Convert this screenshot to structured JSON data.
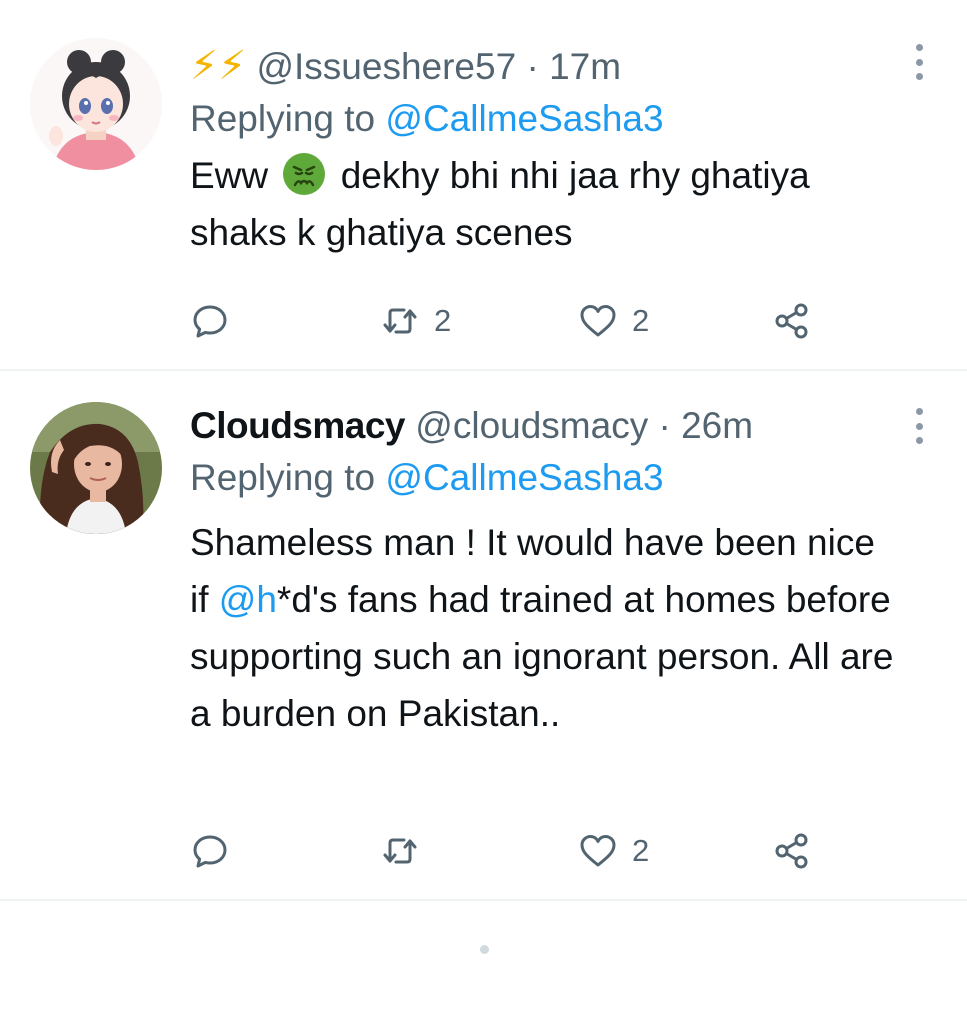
{
  "tweets": [
    {
      "display_name": "",
      "handle": "@Issueshere57",
      "time": "17m",
      "replying_prefix": "Replying to",
      "replying_to": "@CallmeSasha3",
      "text_part1": "Eww",
      "text_part2": "dekhy bhi nhi jaa rhy ghatiya shaks k ghatiya scenes",
      "retweets": "2",
      "likes": "2"
    },
    {
      "display_name": "Cloudsmacy",
      "handle": "@cloudsmacy",
      "time": "26m",
      "replying_prefix": "Replying to",
      "replying_to": "@CallmeSasha3",
      "text_part1": "Shameless man ! It would have been nice if ",
      "text_mention": "@h",
      "text_part2": "*d's fans had trained at homes before supporting such an ignorant person. All are a burden on Pakistan..",
      "retweets": "",
      "likes": "2"
    }
  ],
  "separator": "·",
  "icons": {
    "name_emoji": "lightning-bolt-icon",
    "reply": "speech-bubble-icon",
    "retweet": "retweet-icon",
    "like": "heart-icon",
    "share": "share-icon",
    "more": "vertical-dots-icon",
    "text_emoji": "nauseated-face-icon"
  },
  "colors": {
    "link": "#1d9bf0",
    "secondary_text": "#536471",
    "primary_text": "#0f1419",
    "bolt": "#f4b400"
  }
}
